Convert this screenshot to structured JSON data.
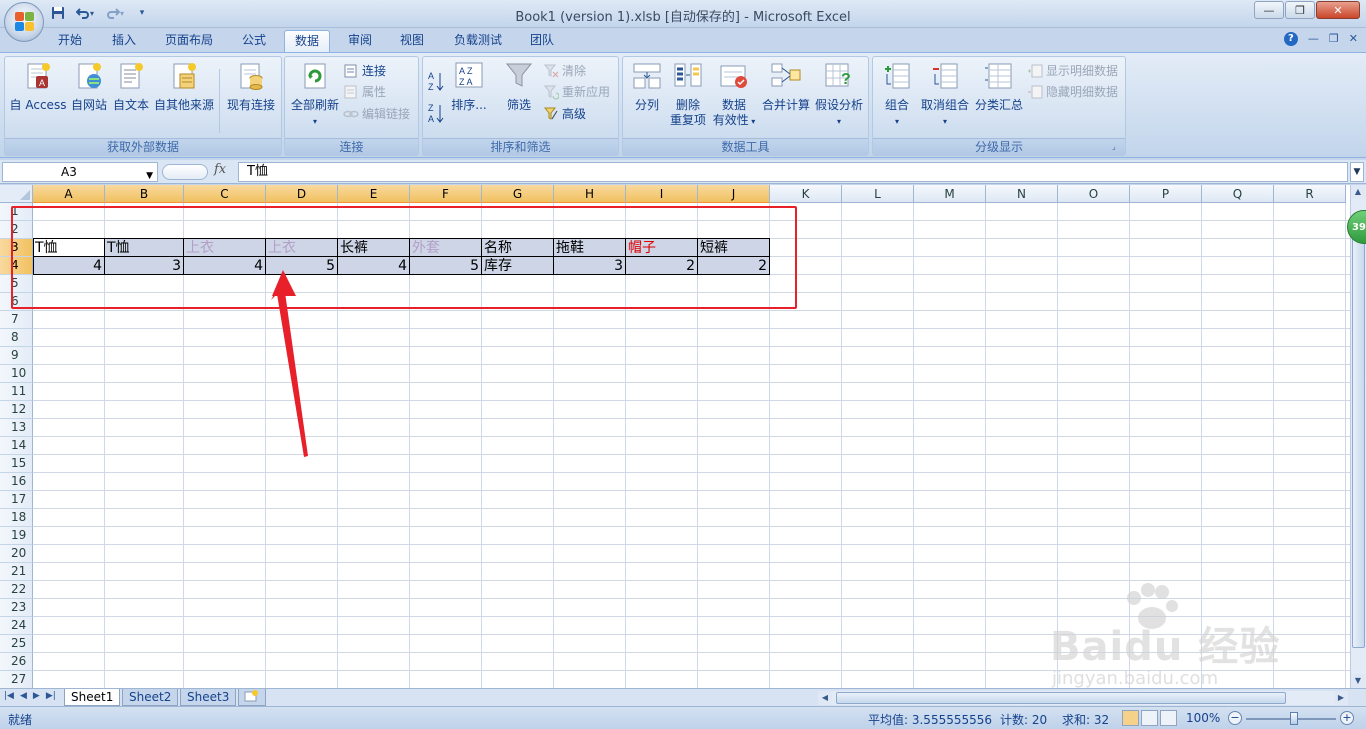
{
  "window": {
    "title": "Book1 (version 1).xlsb [自动保存的] - Microsoft Excel",
    "minimize": "—",
    "restore": "❐",
    "close": "✕"
  },
  "qat": [
    {
      "name": "save-icon",
      "glyph": "💾"
    },
    {
      "name": "undo-icon",
      "glyph": "↶▾"
    },
    {
      "name": "redo-icon",
      "glyph": "↷▾"
    },
    {
      "name": "customize-qat-icon",
      "glyph": "▾"
    }
  ],
  "tabs": [
    "开始",
    "插入",
    "页面布局",
    "公式",
    "数据",
    "审阅",
    "视图",
    "负载测试",
    "团队"
  ],
  "active_tab": "数据",
  "ribbon": {
    "external": {
      "label": "获取外部数据",
      "access": "自 Access",
      "web": "自网站",
      "text": "自文本",
      "other": "自其他来源",
      "existing": "现有连接"
    },
    "connections": {
      "label": "连接",
      "refresh_all": "全部刷新",
      "connections": "连接",
      "properties": "属性",
      "edit_links": "编辑链接"
    },
    "sort_filter": {
      "label": "排序和筛选",
      "sort": "排序...",
      "filter": "筛选",
      "clear": "清除",
      "reapply": "重新应用",
      "advanced": "高级"
    },
    "data_tools": {
      "label": "数据工具",
      "text_to_columns": "分列",
      "remove_dup_1": "删除",
      "remove_dup_2": "重复项",
      "validation_1": "数据",
      "validation_2": "有效性",
      "consolidate": "合并计算",
      "whatif": "假设分析"
    },
    "outline": {
      "label": "分级显示",
      "group": "组合",
      "ungroup": "取消组合",
      "subtotal": "分类汇总",
      "show_detail": "显示明细数据",
      "hide_detail": "隐藏明细数据"
    }
  },
  "formula_bar": {
    "name_box": "A3",
    "fx": "fx",
    "content": "T恤"
  },
  "columns": [
    "A",
    "B",
    "C",
    "D",
    "E",
    "F",
    "G",
    "H",
    "I",
    "J",
    "K",
    "L",
    "M",
    "N",
    "O",
    "P",
    "Q",
    "R"
  ],
  "rows": [
    "1",
    "2",
    "3",
    "4",
    "5",
    "6",
    "7",
    "8",
    "9",
    "10",
    "11",
    "12",
    "13",
    "14",
    "15",
    "16",
    "17",
    "18",
    "19",
    "20",
    "21",
    "22",
    "23",
    "24",
    "25",
    "26",
    "27"
  ],
  "cells": {
    "row3": [
      "T恤",
      "T恤",
      "上衣",
      "上衣",
      "长裤",
      "外套",
      "名称",
      "拖鞋",
      "帽子",
      "短裤"
    ],
    "row4": [
      "4",
      "3",
      "4",
      "5",
      "4",
      "5",
      "库存",
      "3",
      "2",
      "2"
    ]
  },
  "cell_colors": {
    "default": "#000000",
    "faded": "#b3a0c8",
    "red": "#e00000"
  },
  "sheets": [
    "Sheet1",
    "Sheet2",
    "Sheet3"
  ],
  "status": {
    "ready": "就绪",
    "average": "平均值: 3.555555556",
    "count": "计数: 20",
    "sum": "求和: 32",
    "zoom": "100%"
  },
  "side_badge": "39",
  "watermark": {
    "main": "Baidu 经验",
    "url": "jingyan.baidu.com"
  },
  "colors": {
    "accent": "#15428b",
    "annotation": "#e8202a",
    "selected_header": "#f1c15f"
  }
}
